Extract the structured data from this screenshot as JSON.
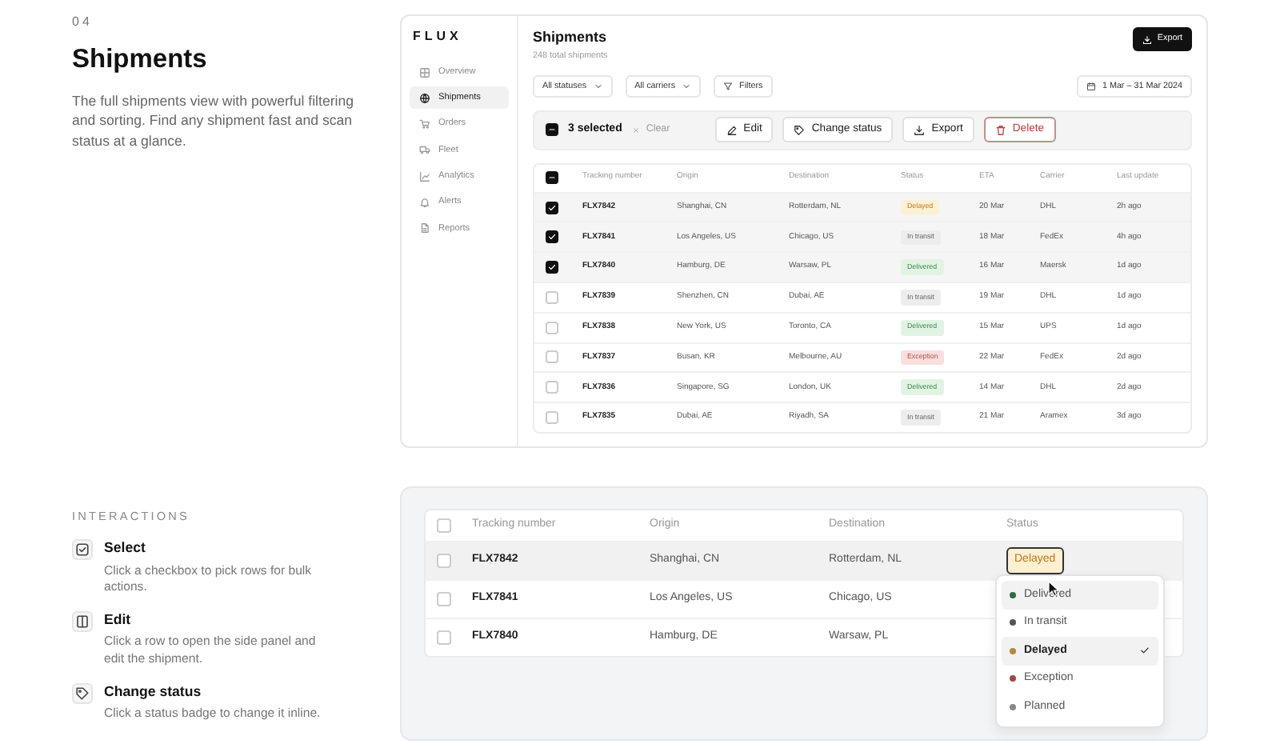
{
  "intro": {
    "number": "04",
    "title": "Shipments",
    "description": "The full shipments view with powerful filtering and sorting. Find any shipment fast and scan status at a glance."
  },
  "interactions": {
    "heading": "INTERACTIONS",
    "items": [
      {
        "kind": "select",
        "title": "Select",
        "description": "Click a checkbox to pick rows for bulk actions."
      },
      {
        "kind": "edit",
        "title": "Edit",
        "description": "Click a row to open the side panel and edit the shipment."
      },
      {
        "kind": "status",
        "title": "Change status",
        "description": "Click a status badge to change it inline."
      }
    ]
  },
  "app": {
    "logo": "FLUX",
    "sidebar": {
      "items": [
        {
          "label": "Overview",
          "selected": false
        },
        {
          "label": "Shipments",
          "selected": true
        },
        {
          "label": "Orders",
          "selected": false
        },
        {
          "label": "Fleet",
          "selected": false
        },
        {
          "label": "Analytics",
          "selected": false
        },
        {
          "label": "Alerts",
          "selected": false
        },
        {
          "label": "Reports",
          "selected": false
        }
      ]
    },
    "title": "Shipments",
    "subtitle": "248 total shipments",
    "export_button": "Export",
    "filters": [
      {
        "label": "All statuses",
        "kind": "dropdown"
      },
      {
        "label": "All carriers",
        "kind": "dropdown"
      },
      {
        "label": "Filters",
        "kind": "filter"
      }
    ],
    "date_range": "1 Mar – 31 Mar 2024",
    "bulk_bar": {
      "indeterminate": true,
      "count": "3 selected",
      "clear": "Clear",
      "actions": [
        {
          "label": "Edit",
          "kind": "edit"
        },
        {
          "label": "Change status",
          "kind": "tag"
        },
        {
          "label": "Export",
          "kind": "export"
        },
        {
          "label": "Delete",
          "kind": "delete"
        }
      ]
    },
    "table": {
      "indeterminate": true,
      "columns": [
        "Tracking number",
        "Origin",
        "Destination",
        "Status",
        "ETA",
        "Carrier",
        "Last update"
      ],
      "rows": [
        {
          "tracking": "FLX7842",
          "origin": "Shanghai, CN",
          "destination": "Rotterdam, NL",
          "status": {
            "label": "Delayed",
            "kind": "delayed"
          },
          "eta": "20 Mar",
          "carrier": "DHL",
          "updated": "2h ago",
          "selected": true
        },
        {
          "tracking": "FLX7841",
          "origin": "Los Angeles, US",
          "destination": "Chicago, US",
          "status": {
            "label": "In transit",
            "kind": "transit"
          },
          "eta": "18 Mar",
          "carrier": "FedEx",
          "updated": "4h ago",
          "selected": true
        },
        {
          "tracking": "FLX7840",
          "origin": "Hamburg, DE",
          "destination": "Warsaw, PL",
          "status": {
            "label": "Delivered",
            "kind": "delivered"
          },
          "eta": "16 Mar",
          "carrier": "Maersk",
          "updated": "1d ago",
          "selected": true
        },
        {
          "tracking": "FLX7839",
          "origin": "Shenzhen, CN",
          "destination": "Dubai, AE",
          "status": {
            "label": "In transit",
            "kind": "transit"
          },
          "eta": "19 Mar",
          "carrier": "DHL",
          "updated": "1d ago",
          "selected": false
        },
        {
          "tracking": "FLX7838",
          "origin": "New York, US",
          "destination": "Toronto, CA",
          "status": {
            "label": "Delivered",
            "kind": "delivered"
          },
          "eta": "15 Mar",
          "carrier": "UPS",
          "updated": "1d ago",
          "selected": false
        },
        {
          "tracking": "FLX7837",
          "origin": "Busan, KR",
          "destination": "Melbourne, AU",
          "status": {
            "label": "Exception",
            "kind": "exception"
          },
          "eta": "22 Mar",
          "carrier": "FedEx",
          "updated": "2d ago",
          "selected": false
        },
        {
          "tracking": "FLX7836",
          "origin": "Singapore, SG",
          "destination": "London, UK",
          "status": {
            "label": "Delivered",
            "kind": "delivered"
          },
          "eta": "14 Mar",
          "carrier": "DHL",
          "updated": "2d ago",
          "selected": false
        },
        {
          "tracking": "FLX7835",
          "origin": "Dubai, AE",
          "destination": "Riyadh, SA",
          "status": {
            "label": "In transit",
            "kind": "transit"
          },
          "eta": "21 Mar",
          "carrier": "Aramex",
          "updated": "3d ago",
          "selected": false
        }
      ]
    }
  },
  "demo": {
    "all_checked": false,
    "columns": [
      "Tracking number",
      "Origin",
      "Destination",
      "Status"
    ],
    "rows": [
      {
        "tracking": "FLX7842",
        "origin": "Shanghai, CN",
        "destination": "Rotterdam, NL",
        "status": {
          "label": "Delayed",
          "kind": "delayed"
        },
        "hovered": true,
        "status_open": true,
        "checked": false
      },
      {
        "tracking": "FLX7841",
        "origin": "Los Angeles, US",
        "destination": "Chicago, US",
        "hovered": false,
        "checked": false
      },
      {
        "tracking": "FLX7840",
        "origin": "Hamburg, DE",
        "destination": "Warsaw, PL",
        "hovered": false,
        "checked": false
      }
    ],
    "menu": [
      {
        "label": "Delivered",
        "color": "#2f6b4a",
        "hovered": true,
        "selected": false
      },
      {
        "label": "In transit",
        "color": "#555555",
        "hovered": false,
        "selected": false
      },
      {
        "label": "Delayed",
        "color": "#b08a3e",
        "hovered": false,
        "selected": true
      },
      {
        "label": "Exception",
        "color": "#a3483f",
        "hovered": false,
        "selected": false
      },
      {
        "label": "Planned",
        "color": "#888888",
        "hovered": false,
        "selected": false
      }
    ]
  }
}
